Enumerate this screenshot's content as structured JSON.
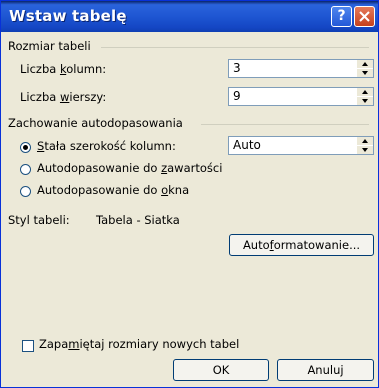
{
  "window": {
    "title": "Wstaw tabelę"
  },
  "title_buttons": {
    "help": "?"
  },
  "size_group": {
    "label": "Rozmiar tabeli",
    "columns_label_pre": "Liczba ",
    "columns_label_key": "k",
    "columns_label_post": "olumn:",
    "columns_value": "3",
    "rows_label_pre": "Liczba ",
    "rows_label_key": "w",
    "rows_label_post": "ierszy:",
    "rows_value": "9"
  },
  "autofit_group": {
    "label": "Zachowanie autodopasowania",
    "fixed_pre": "",
    "fixed_key": "S",
    "fixed_post": "tała szerokość kolumn:",
    "fixed_value": "Auto",
    "contents_pre": "Autodopasowanie do ",
    "contents_key": "z",
    "contents_post": "awartości",
    "window_pre": "Autodopasowanie do ",
    "window_key": "o",
    "window_post": "kna",
    "selected": "fixed"
  },
  "style": {
    "label": "Styl tabeli:",
    "value": "Tabela - Siatka",
    "autoformat_pre": "Auto",
    "autoformat_key": "f",
    "autoformat_post": "ormatowanie..."
  },
  "remember": {
    "pre": "Zapa",
    "key": "m",
    "post": "iętaj rozmiary nowych tabel",
    "checked": false
  },
  "buttons": {
    "ok": "OK",
    "cancel": "Anuluj"
  }
}
